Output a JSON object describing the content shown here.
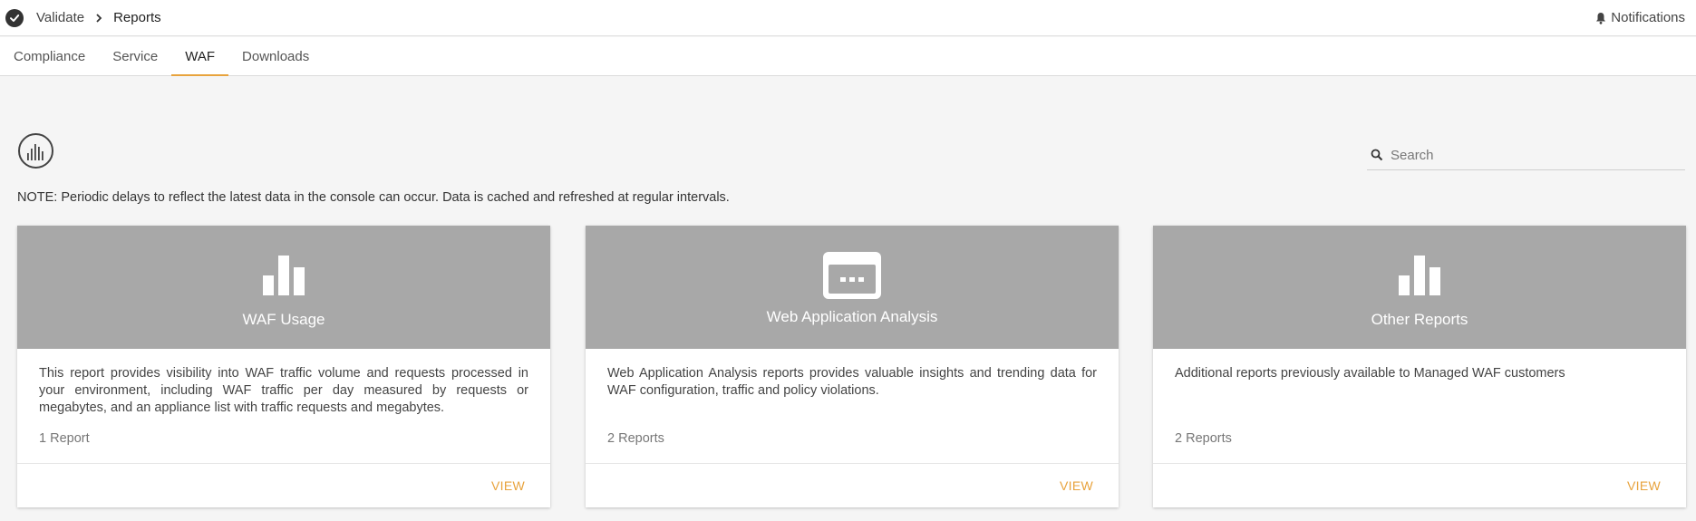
{
  "header": {
    "breadcrumb": [
      "Validate",
      "Reports"
    ],
    "notifications_label": "Notifications"
  },
  "tabs": [
    {
      "label": "Compliance",
      "active": false
    },
    {
      "label": "Service",
      "active": false
    },
    {
      "label": "WAF",
      "active": true
    },
    {
      "label": "Downloads",
      "active": false
    }
  ],
  "search": {
    "placeholder": "Search",
    "value": ""
  },
  "note": "NOTE: Periodic delays to reflect the latest data in the console can occur. Data is cached and refreshed at regular intervals.",
  "cards": [
    {
      "icon": "bar-chart-icon",
      "title": "WAF Usage",
      "description": "This report provides visibility into WAF traffic volume and requests processed in your environment, including WAF traffic per day measured by requests or megabytes, and an appliance list with traffic requests and megabytes.",
      "count": "1 Report",
      "action": "VIEW"
    },
    {
      "icon": "web-window-icon",
      "title": "Web Application Analysis",
      "description": "Web Application Analysis reports provides valuable insights and trending data for WAF configuration, traffic and policy violations.",
      "count": "2 Reports",
      "action": "VIEW"
    },
    {
      "icon": "bar-chart-icon",
      "title": "Other Reports",
      "description": "Additional reports previously available to Managed WAF customers",
      "count": "2 Reports",
      "action": "VIEW"
    }
  ],
  "colors": {
    "accent": "#e8a33d",
    "card_header": "#a8a8a8",
    "background": "#f5f5f5"
  }
}
